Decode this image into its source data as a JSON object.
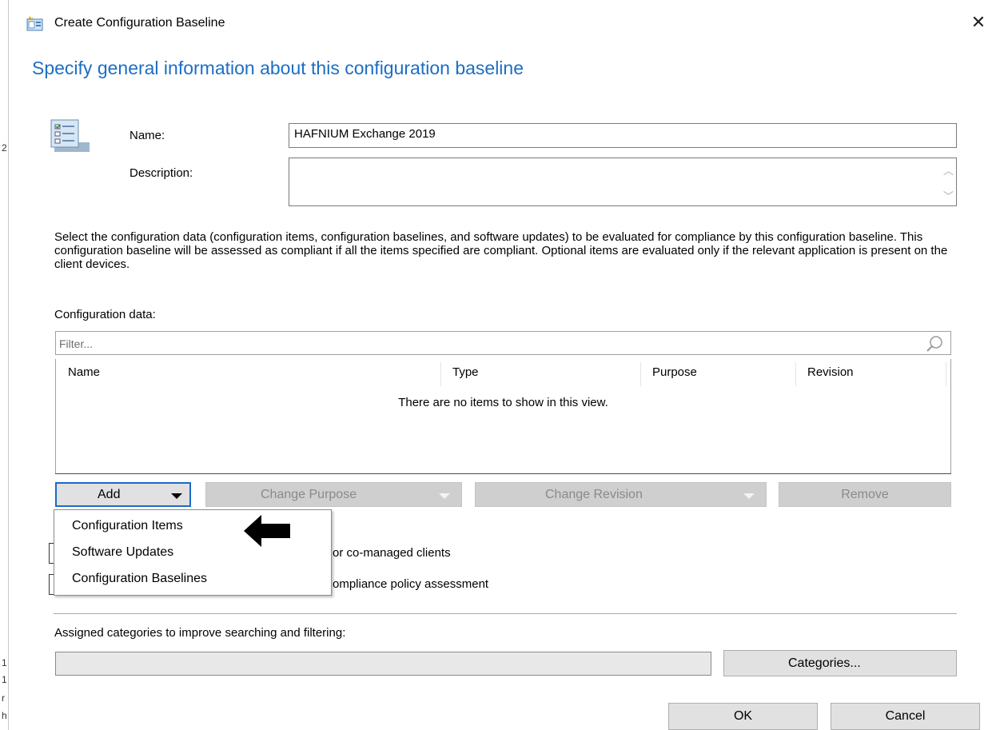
{
  "window": {
    "title": "Create Configuration Baseline",
    "close_glyph": "✕"
  },
  "background_window": {
    "glyphs": [
      "2",
      "1",
      "1",
      "r",
      "h"
    ]
  },
  "page": {
    "header": "Specify general information about this configuration baseline"
  },
  "form": {
    "name_label": "Name:",
    "name_value": "HAFNIUM Exchange 2019",
    "description_label": "Description:",
    "description_value": ""
  },
  "instructions": "Select the configuration data (configuration items, configuration baselines, and software updates) to be evaluated for compliance by this configuration baseline. This configuration baseline will be assessed as compliant if all the items specified are compliant. Optional items are evaluated only if the relevant application is present on  the client devices.",
  "config_data": {
    "label": "Configuration data:",
    "filter_placeholder": "Filter...",
    "columns": [
      "Name",
      "Type",
      "Purpose",
      "Revision"
    ],
    "empty_message": "There are no items to show in this view.",
    "rows": []
  },
  "toolbar": {
    "add_label": "Add",
    "change_purpose_label": "Change Purpose",
    "change_revision_label": "Change Revision",
    "remove_label": "Remove"
  },
  "add_menu": {
    "items": [
      "Configuration Items",
      "Software Updates",
      "Configuration Baselines"
    ]
  },
  "checkboxes": {
    "co_managed_partial": "or co-managed clients",
    "compliance_partial": "ompliance policy assessment"
  },
  "categories": {
    "label": "Assigned categories to improve searching and filtering:",
    "value": "",
    "button_label": "Categories..."
  },
  "footer": {
    "ok_label": "OK",
    "cancel_label": "Cancel"
  },
  "colors": {
    "header_blue": "#1c6ec4",
    "focus_blue": "#1b6ac9"
  }
}
